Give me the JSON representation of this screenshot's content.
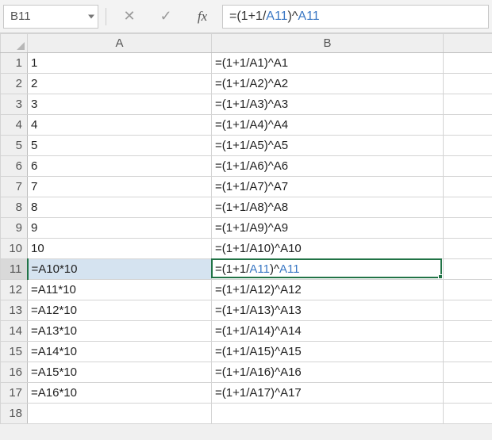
{
  "namebox": {
    "value": "B11"
  },
  "formula_bar": {
    "cancel_glyph": "✕",
    "enter_glyph": "✓",
    "fx_label": "fx",
    "display_parts": {
      "pre": "=(1+1/",
      "ref1": "A11",
      "mid": ")^",
      "ref2": "A11"
    }
  },
  "columns": [
    "A",
    "B"
  ],
  "selection": {
    "active_cell": "B11",
    "row": 11,
    "col": "B"
  },
  "rows": [
    {
      "n": 1,
      "a": "1",
      "b": "=(1+1/A1)^A1"
    },
    {
      "n": 2,
      "a": "2",
      "b": "=(1+1/A2)^A2"
    },
    {
      "n": 3,
      "a": "3",
      "b": "=(1+1/A3)^A3"
    },
    {
      "n": 4,
      "a": "4",
      "b": "=(1+1/A4)^A4"
    },
    {
      "n": 5,
      "a": "5",
      "b": "=(1+1/A5)^A5"
    },
    {
      "n": 6,
      "a": "6",
      "b": "=(1+1/A6)^A6"
    },
    {
      "n": 7,
      "a": "7",
      "b": "=(1+1/A7)^A7"
    },
    {
      "n": 8,
      "a": "8",
      "b": "=(1+1/A8)^A8"
    },
    {
      "n": 9,
      "a": "9",
      "b": "=(1+1/A9)^A9"
    },
    {
      "n": 10,
      "a": "10",
      "b": "=(1+1/A10)^A10"
    },
    {
      "n": 11,
      "a": "=A10*10",
      "b_parts": {
        "pre": "=(1+1/",
        "ref1": "A11",
        "mid": ")^",
        "ref2": "A11"
      }
    },
    {
      "n": 12,
      "a": "=A11*10",
      "b": "=(1+1/A12)^A12"
    },
    {
      "n": 13,
      "a": "=A12*10",
      "b": "=(1+1/A13)^A13"
    },
    {
      "n": 14,
      "a": "=A13*10",
      "b": "=(1+1/A14)^A14"
    },
    {
      "n": 15,
      "a": "=A14*10",
      "b": "=(1+1/A15)^A15"
    },
    {
      "n": 16,
      "a": "=A15*10",
      "b": "=(1+1/A16)^A16"
    },
    {
      "n": 17,
      "a": "=A16*10",
      "b": "=(1+1/A17)^A17"
    },
    {
      "n": 18,
      "a": "",
      "b": ""
    }
  ]
}
